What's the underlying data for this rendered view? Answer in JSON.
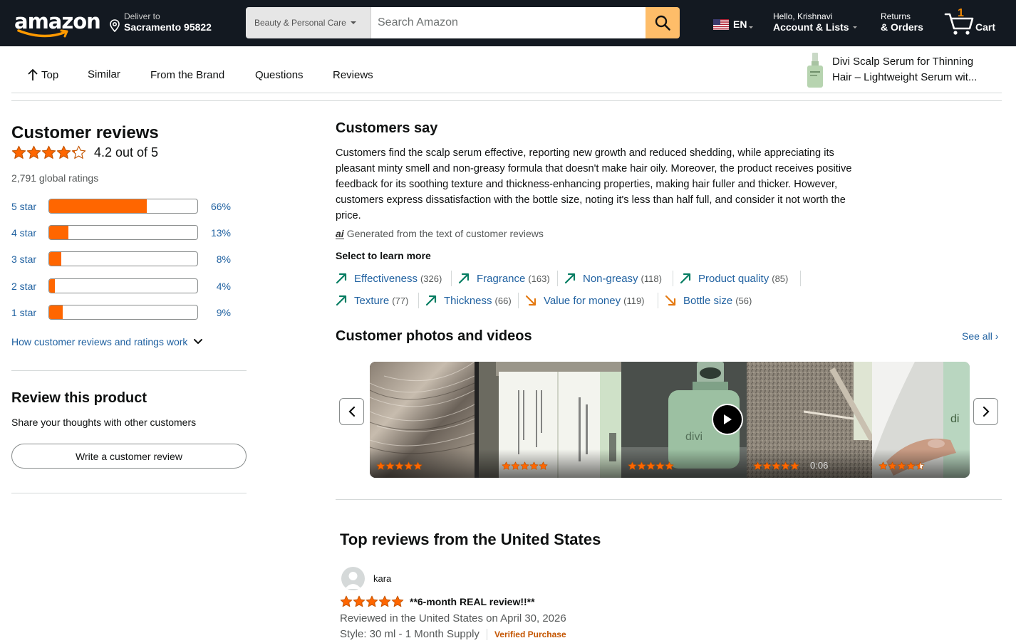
{
  "header": {
    "logo_text": "amazon",
    "deliver_label": "Deliver to",
    "deliver_location": "Sacramento 95822",
    "search_category": "Beauty & Personal Care",
    "search_placeholder": "Search Amazon",
    "language": "EN",
    "account_greeting": "Hello, Krishnavi",
    "account_label": "Account & Lists",
    "returns_line1": "Returns",
    "returns_line2": "& Orders",
    "cart_count": "1",
    "cart_label": "Cart"
  },
  "subnav": {
    "items": [
      "Top",
      "Similar",
      "From the Brand",
      "Questions",
      "Reviews"
    ],
    "product_name_line1": "Divi Scalp Serum for Thinning",
    "product_name_line2": "Hair – Lightweight Serum wit..."
  },
  "reviews_summary": {
    "title": "Customer reviews",
    "rating_value": 4.2,
    "rating_text": "4.2 out of 5",
    "global_ratings": "2,791 global ratings",
    "histogram": [
      {
        "label": "5 star",
        "percent": 66,
        "percent_text": "66%"
      },
      {
        "label": "4 star",
        "percent": 13,
        "percent_text": "13%"
      },
      {
        "label": "3 star",
        "percent": 8,
        "percent_text": "8%"
      },
      {
        "label": "2 star",
        "percent": 4,
        "percent_text": "4%"
      },
      {
        "label": "1 star",
        "percent": 9,
        "percent_text": "9%"
      }
    ],
    "how_link": "How customer reviews and ratings work"
  },
  "review_this": {
    "title": "Review this product",
    "subtitle": "Share your thoughts with other customers",
    "button": "Write a customer review"
  },
  "customers_say": {
    "title": "Customers say",
    "summary": "Customers find the scalp serum effective, reporting new growth and reduced shedding, while appreciating its pleasant minty smell and non-greasy formula that doesn't make hair oily. Moreover, the product receives positive feedback for its soothing texture and thickness-enhancing properties, making hair fuller and thicker. However, customers express dissatisfaction with the bottle size, noting it's less than half full, and consider it not worth the price.",
    "ai_badge": "ai",
    "generated_note": "Generated from the text of customer reviews",
    "select_label": "Select to learn more",
    "aspects": [
      {
        "name": "Effectiveness",
        "count": "(326)",
        "sentiment": "positive"
      },
      {
        "name": "Fragrance",
        "count": "(163)",
        "sentiment": "positive"
      },
      {
        "name": "Non-greasy",
        "count": "(118)",
        "sentiment": "positive"
      },
      {
        "name": "Product quality",
        "count": "(85)",
        "sentiment": "positive"
      },
      {
        "name": "Texture",
        "count": "(77)",
        "sentiment": "positive"
      },
      {
        "name": "Thickness",
        "count": "(66)",
        "sentiment": "positive"
      },
      {
        "name": "Value for money",
        "count": "(119)",
        "sentiment": "negative"
      },
      {
        "name": "Bottle size",
        "count": "(56)",
        "sentiment": "negative"
      }
    ],
    "positive_color": "#067D62",
    "negative_color": "#E47911"
  },
  "photos": {
    "title": "Customer photos and videos",
    "see_all": "See all",
    "tiles": [
      {
        "stars": 5,
        "is_video": false,
        "duration": ""
      },
      {
        "stars": 5,
        "is_video": false,
        "duration": ""
      },
      {
        "stars": 5,
        "is_video": true,
        "duration": ""
      },
      {
        "stars": 5,
        "is_video": false,
        "duration": "0:06"
      },
      {
        "stars": 4.5,
        "is_video": false,
        "duration": ""
      }
    ]
  },
  "top_reviews": {
    "title": "Top reviews from the United States",
    "review": {
      "author": "kara",
      "stars": 5,
      "title": "**6-month REAL review!!**",
      "date": "Reviewed in the United States on April 30, 2026",
      "style": "Style: 30 ml - 1 Month Supply",
      "verified": "Verified Purchase"
    }
  },
  "colors": {
    "header_bg": "#131921",
    "star_color": "#FF6600",
    "bar_fill": "#FF6600",
    "link": "#2162A1",
    "search_button": "#FEBD69"
  }
}
